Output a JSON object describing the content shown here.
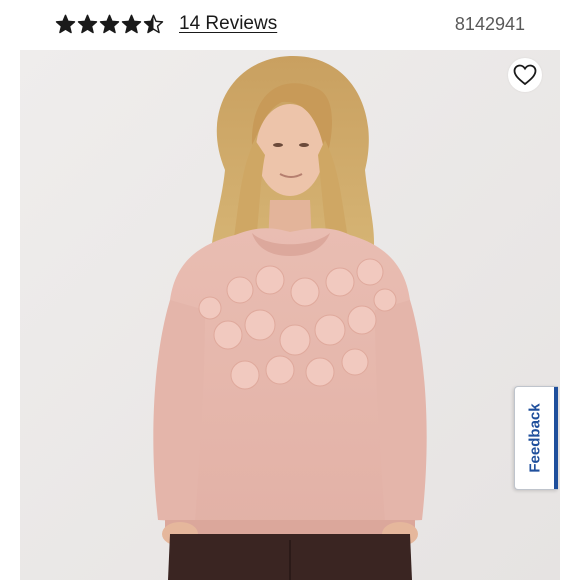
{
  "product": {
    "rating": 4.5,
    "rating_max": 5,
    "reviews_label": "14 Reviews",
    "sku": "8142941"
  },
  "icons": {
    "star": "star-icon",
    "wishlist": "heart-outline-icon"
  },
  "feedback": {
    "label": "Feedback"
  },
  "colors": {
    "star": "#1a1a1a",
    "feedback_accent": "#1f4f9c",
    "sweater": "#e7b8ae",
    "pants": "#3a2522"
  }
}
